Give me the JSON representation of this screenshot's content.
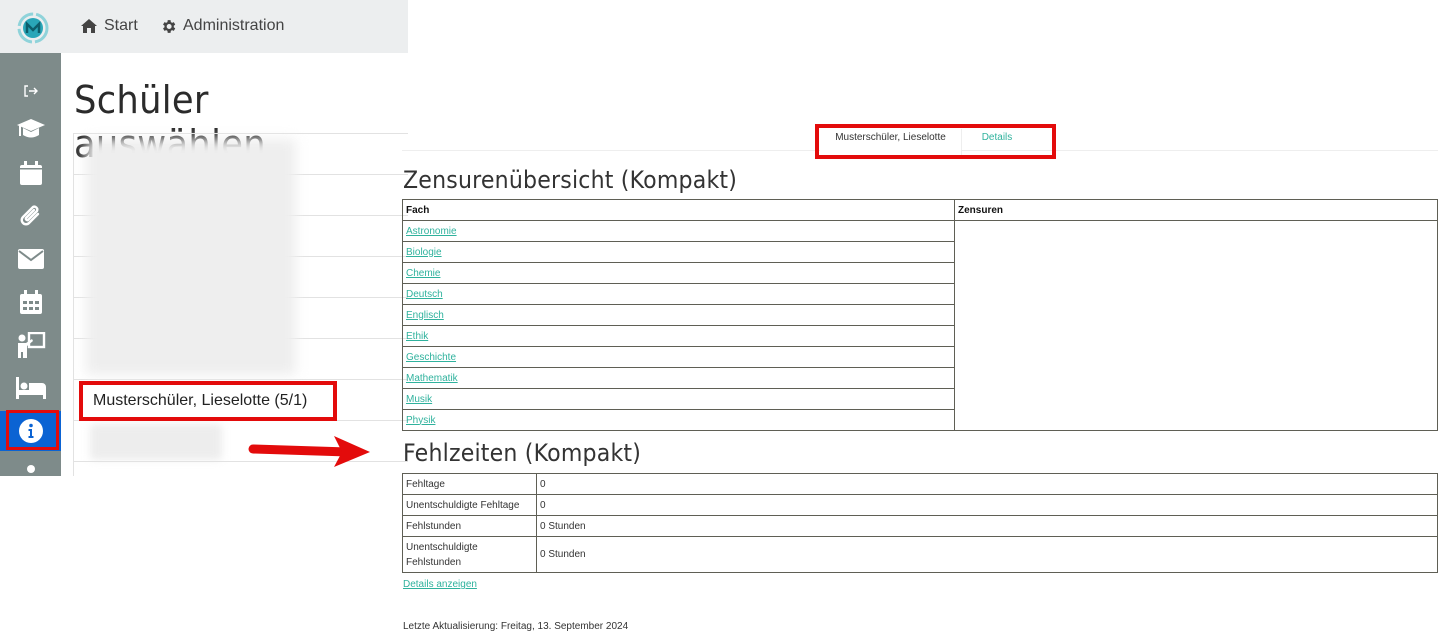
{
  "header": {
    "nav": [
      {
        "label": "Start",
        "icon": "home-icon"
      },
      {
        "label": "Administration",
        "icon": "gear-icon"
      }
    ]
  },
  "sidebar": {
    "items": [
      {
        "icon": "logout-icon"
      },
      {
        "icon": "graduation-cap-icon"
      },
      {
        "icon": "calendar-icon"
      },
      {
        "icon": "paperclip-icon"
      },
      {
        "icon": "envelope-icon"
      },
      {
        "icon": "calendar-grid-icon"
      },
      {
        "icon": "teacher-board-icon"
      },
      {
        "icon": "bed-icon"
      },
      {
        "icon": "info-icon",
        "active": true
      },
      {
        "icon": "user-group-icon"
      }
    ],
    "active_color": "#0b63d3"
  },
  "student_select": {
    "title": "Schüler auswählen",
    "selected_student": "Musterschüler, Lieselotte (5/1)"
  },
  "detail": {
    "tabs": [
      {
        "label": "Musterschüler, Lieselotte",
        "active": true
      },
      {
        "label": "Details",
        "active": false
      }
    ],
    "grades": {
      "title": "Zensurenübersicht (Kompakt)",
      "columns": [
        "Fach",
        "Zensuren"
      ],
      "subjects": [
        "Astronomie",
        "Biologie",
        "Chemie",
        "Deutsch",
        "Englisch",
        "Ethik",
        "Geschichte",
        "Mathematik",
        "Musik",
        "Physik"
      ]
    },
    "absences": {
      "title": "Fehlzeiten (Kompakt)",
      "rows": [
        {
          "label": "Fehltage",
          "value": "0"
        },
        {
          "label": "Unentschuldigte Fehltage",
          "value": "0"
        },
        {
          "label": "Fehlstunden",
          "value": "0 Stunden"
        },
        {
          "label": "Unentschuldigte Fehlstunden",
          "value": "0 Stunden"
        }
      ]
    },
    "details_link": "Details anzeigen",
    "last_update": "Letzte Aktualisierung: Freitag, 13. September 2024"
  },
  "colors": {
    "link": "#2fb29d",
    "highlight": "#e30b0b",
    "sidebar": "#7e8b8a",
    "topbar": "#eceeef"
  }
}
